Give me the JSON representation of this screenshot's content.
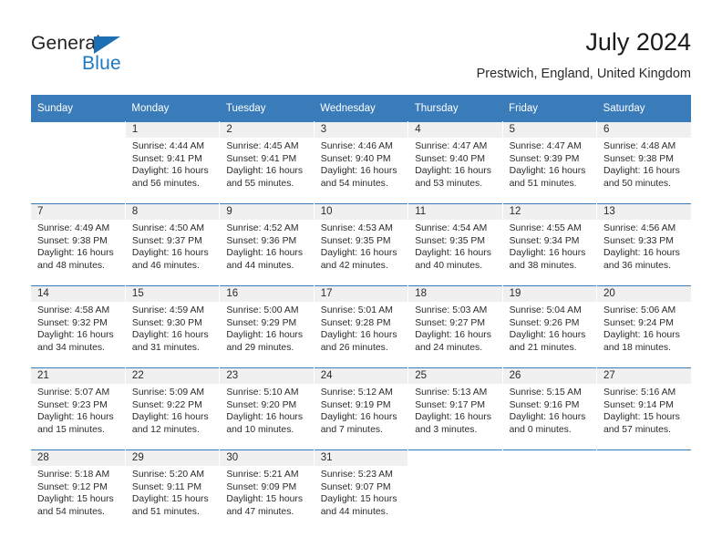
{
  "brand": {
    "name_top": "General",
    "name_bottom": "Blue",
    "accent_color": "#1c7ac4"
  },
  "header": {
    "title": "July 2024",
    "location": "Prestwich, England, United Kingdom"
  },
  "calendar": {
    "header_bg": "#3a7cba",
    "daynum_bg": "#f0f0f0",
    "weekdays": [
      "Sunday",
      "Monday",
      "Tuesday",
      "Wednesday",
      "Thursday",
      "Friday",
      "Saturday"
    ],
    "weeks": [
      [
        {
          "day": "",
          "lines": []
        },
        {
          "day": "1",
          "lines": [
            "Sunrise: 4:44 AM",
            "Sunset: 9:41 PM",
            "Daylight: 16 hours",
            "and 56 minutes."
          ]
        },
        {
          "day": "2",
          "lines": [
            "Sunrise: 4:45 AM",
            "Sunset: 9:41 PM",
            "Daylight: 16 hours",
            "and 55 minutes."
          ]
        },
        {
          "day": "3",
          "lines": [
            "Sunrise: 4:46 AM",
            "Sunset: 9:40 PM",
            "Daylight: 16 hours",
            "and 54 minutes."
          ]
        },
        {
          "day": "4",
          "lines": [
            "Sunrise: 4:47 AM",
            "Sunset: 9:40 PM",
            "Daylight: 16 hours",
            "and 53 minutes."
          ]
        },
        {
          "day": "5",
          "lines": [
            "Sunrise: 4:47 AM",
            "Sunset: 9:39 PM",
            "Daylight: 16 hours",
            "and 51 minutes."
          ]
        },
        {
          "day": "6",
          "lines": [
            "Sunrise: 4:48 AM",
            "Sunset: 9:38 PM",
            "Daylight: 16 hours",
            "and 50 minutes."
          ]
        }
      ],
      [
        {
          "day": "7",
          "lines": [
            "Sunrise: 4:49 AM",
            "Sunset: 9:38 PM",
            "Daylight: 16 hours",
            "and 48 minutes."
          ]
        },
        {
          "day": "8",
          "lines": [
            "Sunrise: 4:50 AM",
            "Sunset: 9:37 PM",
            "Daylight: 16 hours",
            "and 46 minutes."
          ]
        },
        {
          "day": "9",
          "lines": [
            "Sunrise: 4:52 AM",
            "Sunset: 9:36 PM",
            "Daylight: 16 hours",
            "and 44 minutes."
          ]
        },
        {
          "day": "10",
          "lines": [
            "Sunrise: 4:53 AM",
            "Sunset: 9:35 PM",
            "Daylight: 16 hours",
            "and 42 minutes."
          ]
        },
        {
          "day": "11",
          "lines": [
            "Sunrise: 4:54 AM",
            "Sunset: 9:35 PM",
            "Daylight: 16 hours",
            "and 40 minutes."
          ]
        },
        {
          "day": "12",
          "lines": [
            "Sunrise: 4:55 AM",
            "Sunset: 9:34 PM",
            "Daylight: 16 hours",
            "and 38 minutes."
          ]
        },
        {
          "day": "13",
          "lines": [
            "Sunrise: 4:56 AM",
            "Sunset: 9:33 PM",
            "Daylight: 16 hours",
            "and 36 minutes."
          ]
        }
      ],
      [
        {
          "day": "14",
          "lines": [
            "Sunrise: 4:58 AM",
            "Sunset: 9:32 PM",
            "Daylight: 16 hours",
            "and 34 minutes."
          ]
        },
        {
          "day": "15",
          "lines": [
            "Sunrise: 4:59 AM",
            "Sunset: 9:30 PM",
            "Daylight: 16 hours",
            "and 31 minutes."
          ]
        },
        {
          "day": "16",
          "lines": [
            "Sunrise: 5:00 AM",
            "Sunset: 9:29 PM",
            "Daylight: 16 hours",
            "and 29 minutes."
          ]
        },
        {
          "day": "17",
          "lines": [
            "Sunrise: 5:01 AM",
            "Sunset: 9:28 PM",
            "Daylight: 16 hours",
            "and 26 minutes."
          ]
        },
        {
          "day": "18",
          "lines": [
            "Sunrise: 5:03 AM",
            "Sunset: 9:27 PM",
            "Daylight: 16 hours",
            "and 24 minutes."
          ]
        },
        {
          "day": "19",
          "lines": [
            "Sunrise: 5:04 AM",
            "Sunset: 9:26 PM",
            "Daylight: 16 hours",
            "and 21 minutes."
          ]
        },
        {
          "day": "20",
          "lines": [
            "Sunrise: 5:06 AM",
            "Sunset: 9:24 PM",
            "Daylight: 16 hours",
            "and 18 minutes."
          ]
        }
      ],
      [
        {
          "day": "21",
          "lines": [
            "Sunrise: 5:07 AM",
            "Sunset: 9:23 PM",
            "Daylight: 16 hours",
            "and 15 minutes."
          ]
        },
        {
          "day": "22",
          "lines": [
            "Sunrise: 5:09 AM",
            "Sunset: 9:22 PM",
            "Daylight: 16 hours",
            "and 12 minutes."
          ]
        },
        {
          "day": "23",
          "lines": [
            "Sunrise: 5:10 AM",
            "Sunset: 9:20 PM",
            "Daylight: 16 hours",
            "and 10 minutes."
          ]
        },
        {
          "day": "24",
          "lines": [
            "Sunrise: 5:12 AM",
            "Sunset: 9:19 PM",
            "Daylight: 16 hours",
            "and 7 minutes."
          ]
        },
        {
          "day": "25",
          "lines": [
            "Sunrise: 5:13 AM",
            "Sunset: 9:17 PM",
            "Daylight: 16 hours",
            "and 3 minutes."
          ]
        },
        {
          "day": "26",
          "lines": [
            "Sunrise: 5:15 AM",
            "Sunset: 9:16 PM",
            "Daylight: 16 hours",
            "and 0 minutes."
          ]
        },
        {
          "day": "27",
          "lines": [
            "Sunrise: 5:16 AM",
            "Sunset: 9:14 PM",
            "Daylight: 15 hours",
            "and 57 minutes."
          ]
        }
      ],
      [
        {
          "day": "28",
          "lines": [
            "Sunrise: 5:18 AM",
            "Sunset: 9:12 PM",
            "Daylight: 15 hours",
            "and 54 minutes."
          ]
        },
        {
          "day": "29",
          "lines": [
            "Sunrise: 5:20 AM",
            "Sunset: 9:11 PM",
            "Daylight: 15 hours",
            "and 51 minutes."
          ]
        },
        {
          "day": "30",
          "lines": [
            "Sunrise: 5:21 AM",
            "Sunset: 9:09 PM",
            "Daylight: 15 hours",
            "and 47 minutes."
          ]
        },
        {
          "day": "31",
          "lines": [
            "Sunrise: 5:23 AM",
            "Sunset: 9:07 PM",
            "Daylight: 15 hours",
            "and 44 minutes."
          ]
        },
        {
          "day": "",
          "lines": []
        },
        {
          "day": "",
          "lines": []
        },
        {
          "day": "",
          "lines": []
        }
      ]
    ]
  }
}
